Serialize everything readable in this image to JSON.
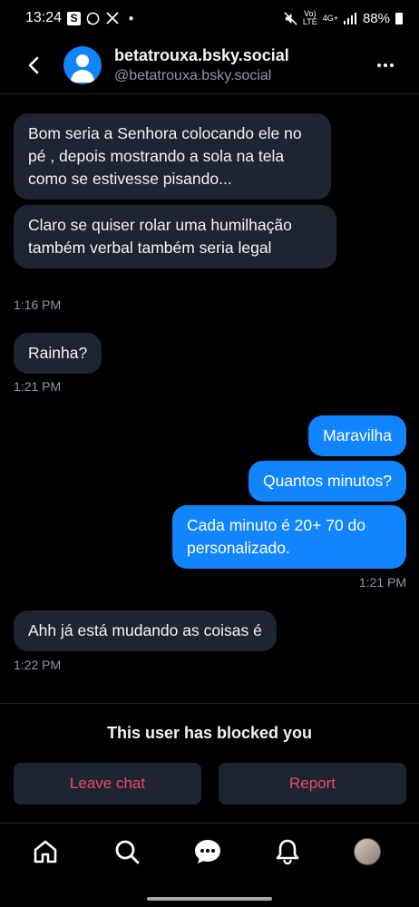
{
  "status_bar": {
    "time": "13:24",
    "app_icons": [
      "samsung-icon",
      "whatsapp-icon",
      "x-icon"
    ],
    "network_top": "Vo)",
    "network_lte": "LTE",
    "network_4g": "4G+",
    "battery": "88%"
  },
  "header": {
    "display_name": "betatrouxa.bsky.social",
    "handle": "@betatrouxa.bsky.social"
  },
  "messages": [
    {
      "direction": "incoming",
      "text": "Bom seria a Senhora colocando ele no pé , depois mostrando a sola na tela como se estivesse pisando..."
    },
    {
      "direction": "incoming",
      "text": "Claro se quiser rolar uma humilhação também verbal também seria legal"
    },
    {
      "direction": "incoming",
      "text": "Rainha?"
    },
    {
      "direction": "outgoing",
      "text": "Maravilha"
    },
    {
      "direction": "outgoing",
      "text": "Quantos minutos?"
    },
    {
      "direction": "outgoing",
      "text": "Cada minuto é 20+ 70 do personalizado."
    },
    {
      "direction": "incoming",
      "text": "Ahh já está mudando as coisas é"
    }
  ],
  "timestamps": [
    "1:16 PM",
    "1:21 PM",
    "1:21 PM",
    "1:22 PM"
  ],
  "blocked": {
    "message": "This user has blocked you",
    "leave_label": "Leave chat",
    "report_label": "Report"
  },
  "colors": {
    "accent": "#1185fe",
    "incoming_bubble": "#1e2530",
    "danger": "#ec4868",
    "muted": "#8d99a8"
  },
  "nav": [
    "home-icon",
    "search-icon",
    "chat-icon",
    "bell-icon",
    "profile-avatar"
  ]
}
